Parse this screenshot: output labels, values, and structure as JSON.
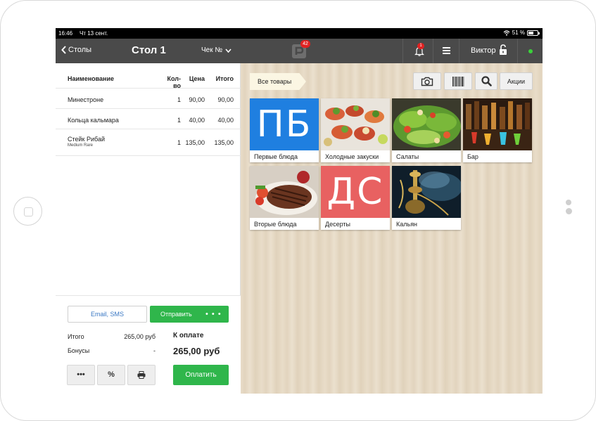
{
  "status_bar": {
    "time": "16:46",
    "date": "Чт 13 сент.",
    "battery": "51 %"
  },
  "nav": {
    "back_label": "Столы",
    "title": "Стол 1",
    "check_label": "Чек №",
    "logo_badge": "42",
    "bell_badge": "1",
    "user": "Виктор",
    "online_color": "#3ad13a"
  },
  "order": {
    "columns": {
      "name": "Наименование",
      "qty": "Кол-во",
      "price": "Цена",
      "total": "Итого"
    },
    "rows": [
      {
        "name": "Минестроне",
        "modifier": "",
        "qty": "1",
        "price": "90,00",
        "total": "90,00"
      },
      {
        "name": "Кольца кальмара",
        "modifier": "",
        "qty": "1",
        "price": "40,00",
        "total": "40,00"
      },
      {
        "name": "Стейк Рибай",
        "modifier": "Medium Rare",
        "qty": "1",
        "price": "135,00",
        "total": "135,00"
      }
    ]
  },
  "footer": {
    "email_button": "Email, SMS",
    "send_button": "Отправить",
    "send_dots": "• • •",
    "total_label": "Итого",
    "total_value": "265,00 руб",
    "bonus_label": "Бонусы",
    "bonus_value": "-",
    "to_pay_label": "К оплате",
    "to_pay_value": "265,00 руб",
    "more_button": "•••",
    "discount_button": "%",
    "pay_button": "Оплатить",
    "accent_color": "#2fb64b"
  },
  "catalog": {
    "all_goods": "Все товары",
    "promo_button": "Акции",
    "tiles": [
      {
        "label": "Первые блюда",
        "mono": "ПБ",
        "color": "#1f7fe0"
      },
      {
        "label": "Холодные закуски",
        "image": "canapes"
      },
      {
        "label": "Салаты",
        "image": "salad"
      },
      {
        "label": "Бар",
        "image": "bar"
      },
      {
        "label": "Вторые блюда",
        "image": "steak"
      },
      {
        "label": "Десерты",
        "mono": "ДС",
        "color": "#e86161"
      },
      {
        "label": "Кальян",
        "image": "hookah"
      }
    ]
  }
}
